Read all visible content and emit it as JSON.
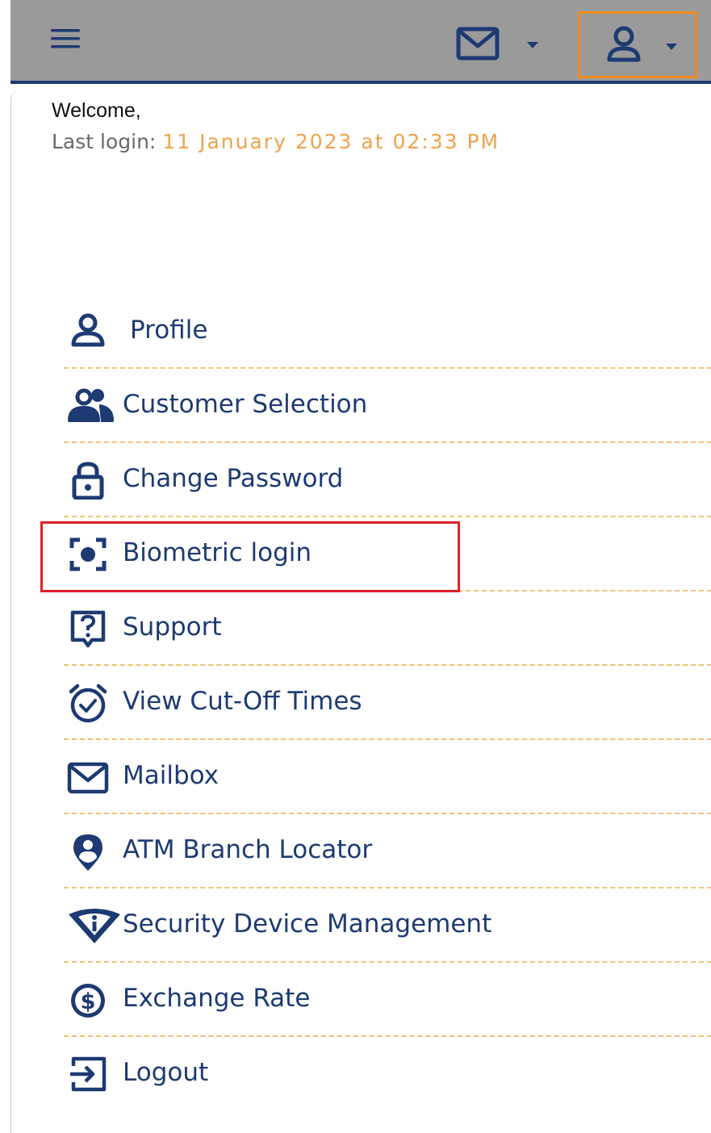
{
  "header": {
    "menu_icon": "hamburger-menu-icon",
    "mail_icon": "envelope-icon",
    "user_icon": "user-icon",
    "caret_icon": "caret-down-icon",
    "bar_color": "#9a9a9a",
    "accent_color": "#1d3a72",
    "user_highlight_color": "#f28a1e"
  },
  "welcome": {
    "greeting": "Welcome,",
    "last_login_label": "Last login:",
    "last_login_value": "11 January 2023 at 02:33 PM",
    "last_login_value_color": "#f0a24a"
  },
  "menu": {
    "items": [
      {
        "label": "Profile",
        "icon": "user-icon"
      },
      {
        "label": "Customer Selection",
        "icon": "users-icon"
      },
      {
        "label": "Change Password",
        "icon": "lock-icon"
      },
      {
        "label": "Biometric login",
        "icon": "face-scan-icon"
      },
      {
        "label": "Support",
        "icon": "question-icon"
      },
      {
        "label": "View Cut-Off Times",
        "icon": "alarm-clock-icon"
      },
      {
        "label": "Mailbox",
        "icon": "envelope-icon"
      },
      {
        "label": "ATM Branch Locator",
        "icon": "location-pin-icon"
      },
      {
        "label": "Security Device Management",
        "icon": "security-shield-icon"
      },
      {
        "label": "Exchange Rate",
        "icon": "dollar-circle-icon"
      },
      {
        "label": "Logout",
        "icon": "logout-icon"
      }
    ],
    "highlighted_item": "Biometric login",
    "highlight_color": "#e0202a",
    "divider_color": "#f3c27a"
  }
}
